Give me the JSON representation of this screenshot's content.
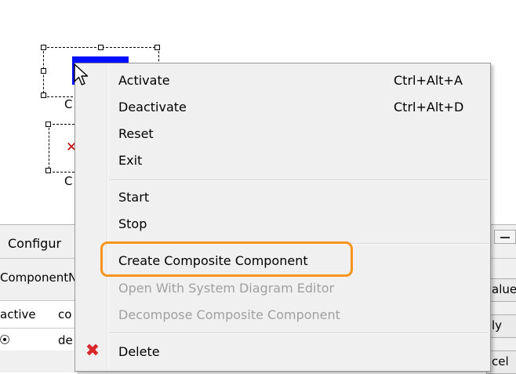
{
  "diagram": {
    "components": [
      {
        "label": "C"
      },
      {
        "label": "C"
      }
    ]
  },
  "panel": {
    "tab_label": "Configur",
    "field_label": "ComponentN",
    "columns": [
      "active",
      "co"
    ],
    "row": {
      "active": "",
      "name": "de"
    },
    "right_buttons": [
      "alue",
      "ly",
      "cel"
    ]
  },
  "context_menu": {
    "items": [
      {
        "label": "Activate",
        "shortcut": "Ctrl+Alt+A",
        "enabled": true
      },
      {
        "label": "Deactivate",
        "shortcut": "Ctrl+Alt+D",
        "enabled": true
      },
      {
        "label": "Reset",
        "enabled": true
      },
      {
        "label": "Exit",
        "enabled": true
      },
      {
        "label": "Start",
        "enabled": true
      },
      {
        "label": "Stop",
        "enabled": true
      },
      {
        "label": "Create Composite Component",
        "enabled": true,
        "highlighted": true
      },
      {
        "label": "Open With System Diagram Editor",
        "enabled": false
      },
      {
        "label": "Decompose Composite Component",
        "enabled": false
      },
      {
        "label": "Delete",
        "enabled": true,
        "icon": "delete-x-icon"
      }
    ]
  },
  "colors": {
    "highlight_outline": "#f7941d",
    "delete_icon": "#d8262c",
    "selected_component": "#0010ff"
  }
}
